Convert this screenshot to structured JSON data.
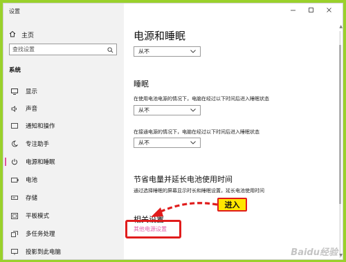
{
  "window": {
    "title": "设置",
    "controls": [
      "minimize-icon",
      "maximize-icon",
      "close-icon"
    ]
  },
  "sidebar": {
    "home_label": "主页",
    "search_placeholder": "查找设置",
    "section_title": "系统",
    "items": [
      {
        "label": "显示",
        "icon": "monitor-icon"
      },
      {
        "label": "声音",
        "icon": "speaker-icon"
      },
      {
        "label": "通知和操作",
        "icon": "notification-icon"
      },
      {
        "label": "专注助手",
        "icon": "moon-icon"
      },
      {
        "label": "电源和睡眠",
        "icon": "power-icon",
        "active": true
      },
      {
        "label": "电池",
        "icon": "battery-icon"
      },
      {
        "label": "存储",
        "icon": "storage-icon"
      },
      {
        "label": "平板模式",
        "icon": "tablet-icon"
      },
      {
        "label": "多任务处理",
        "icon": "multitask-icon"
      },
      {
        "label": "投影到此电脑",
        "icon": "project-icon"
      }
    ]
  },
  "content": {
    "page_title": "电源和睡眠",
    "screen_select_value": "从不",
    "sleep_heading": "睡眠",
    "sleep_battery_desc": "在使用电池电源的情况下，电脑在经过以下时间后进入睡眠状态",
    "sleep_battery_value": "从不",
    "sleep_plugged_desc": "在接通电源的情况下，电脑在经过以下时间后进入睡眠状态",
    "sleep_plugged_value": "从不",
    "battery_heading": "节省电量并延长电池使用时间",
    "battery_desc": "通过选择睡眠的屏幕显示时长和睡眠设置，延长电池使用时间",
    "related_heading": "相关设置",
    "related_link": "其他电源设置"
  },
  "annotation": {
    "callout_text": "进入",
    "color": "#e01c1c",
    "callout_bg": "#ffe600"
  },
  "watermark": "Baidu经验",
  "colors": {
    "background_green": "#9ad12b",
    "accent_pink": "#e25da9"
  }
}
